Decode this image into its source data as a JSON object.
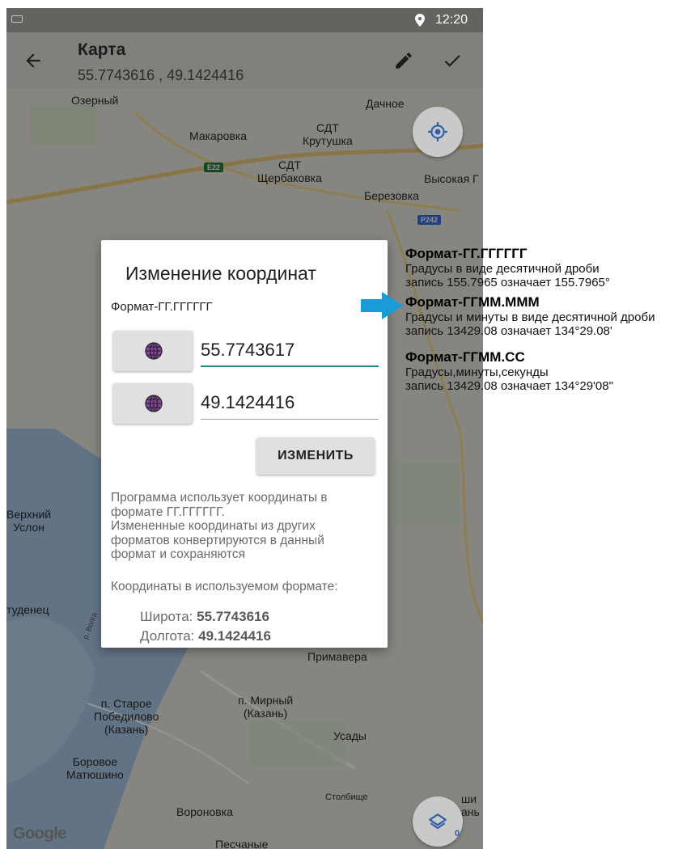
{
  "status_bar": {
    "time": "12:20"
  },
  "app_bar": {
    "title": "Карта",
    "subtitle": "55.7743616 , 49.1424416"
  },
  "map": {
    "labels": {
      "ozerny": "Озерный",
      "dachnoe": "Дачное",
      "makarovka": "Макаровка",
      "sdt_krutushka": "СДТ\nКрутушка",
      "sdt_sherbakovka": "СДТ\nЩербаковка",
      "vysokaya": "Высокая Г",
      "berezovka": "Березовка",
      "verkhny_uslon": "Верхний\nУслон",
      "studenets": "туденец",
      "volga": "р. Волга",
      "primavera": "Примавера",
      "staroe_pobedilovo": "п. Старое\nПобедилово\n(Казань)",
      "mirny": "п. Мирный\n(Казань)",
      "usady": "Усады",
      "borovoe": "Боровое\nМатюшино",
      "stolbishe": "Столбище",
      "voronovka": "Вороновка",
      "peschanye": "Песчаные",
      "shi": "ши\nань"
    },
    "road_badges": {
      "e22": "E22",
      "r242": "Р242"
    },
    "layers_count": "0",
    "google": "Google"
  },
  "dialog": {
    "title": "Изменение координат",
    "format_selected": "Формат-ГГ.ГГГГГГ",
    "latitude_value": "55.7743617",
    "longitude_value": "49.1424416",
    "change_button": "ИЗМЕНИТЬ",
    "info_lines": [
      "Программа использует координаты в",
      "формате ГГ.ГГГГГГ.",
      "Измененные координаты из других",
      "форматов конвертируются в данный",
      "формат и сохраняются"
    ],
    "coords_in_format_label": "Координаты в используемом формате:",
    "lat_label": "Широта:",
    "lat_value": "55.7743616",
    "lon_label": "Долгота:",
    "lon_value": "49.1424416"
  },
  "annotation": {
    "formats": [
      {
        "heading": "Формат-ГГ.ГГГГГГ",
        "lines": [
          "Градусы в виде десятичной дроби",
          "запись 155.7965 означает 155.7965°"
        ]
      },
      {
        "heading": "Формат-ГГММ.МММ",
        "lines": [
          "Градусы и минуты в виде десятичной дроби",
          "запись 13429.08 означает 134°29.08'"
        ]
      },
      {
        "heading": "Формат-ГГММ.СС",
        "lines": [
          "Градусы,минуты,секунды",
          "запись 13429.08 означает 134°29'08\""
        ]
      }
    ]
  },
  "colors": {
    "accent": "#1e8f7f",
    "arrow": "#1a9ad6",
    "globe": "#8e3fa8"
  }
}
